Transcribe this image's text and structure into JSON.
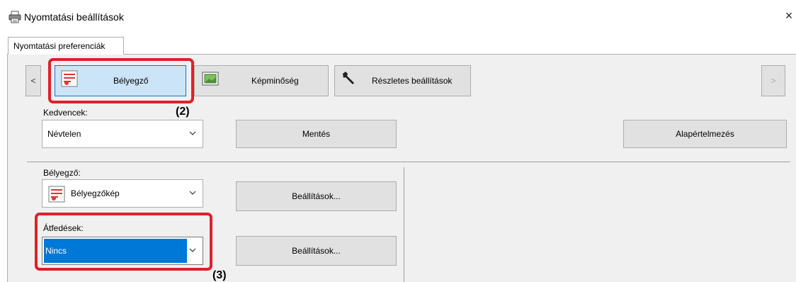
{
  "window": {
    "title": "Nyomtatási beállítások",
    "close_glyph": "×",
    "icon": "printer-icon"
  },
  "tab": {
    "label": "Nyomtatási preferenciák"
  },
  "toolbar": {
    "prev_glyph": "<",
    "next_glyph": ">",
    "tabs": [
      {
        "label": "Bélyegző",
        "icon": "stamp-icon",
        "selected": true
      },
      {
        "label": "Képminőség",
        "icon": "image-quality-icon",
        "selected": false
      },
      {
        "label": "Részletes beállítások",
        "icon": "wrench-icon",
        "selected": false
      }
    ]
  },
  "favorites": {
    "label": "Kedvencek:",
    "value": "Névtelen",
    "save_label": "Mentés",
    "defaults_label": "Alapértelmezés"
  },
  "stamp": {
    "label": "Bélyegző:",
    "value": "Bélyegzőkép",
    "settings_label": "Beállítások..."
  },
  "overlay": {
    "label": "Átfedések:",
    "value": "Nincs",
    "settings_label": "Beállítások..."
  },
  "callouts": {
    "step2": "(2)",
    "step3": "(3)"
  },
  "colors": {
    "accent": "#0078d7",
    "selected_tab_bg": "#cce4f7",
    "highlight": "#e0202a",
    "panel_bg": "#f0f0f0"
  }
}
